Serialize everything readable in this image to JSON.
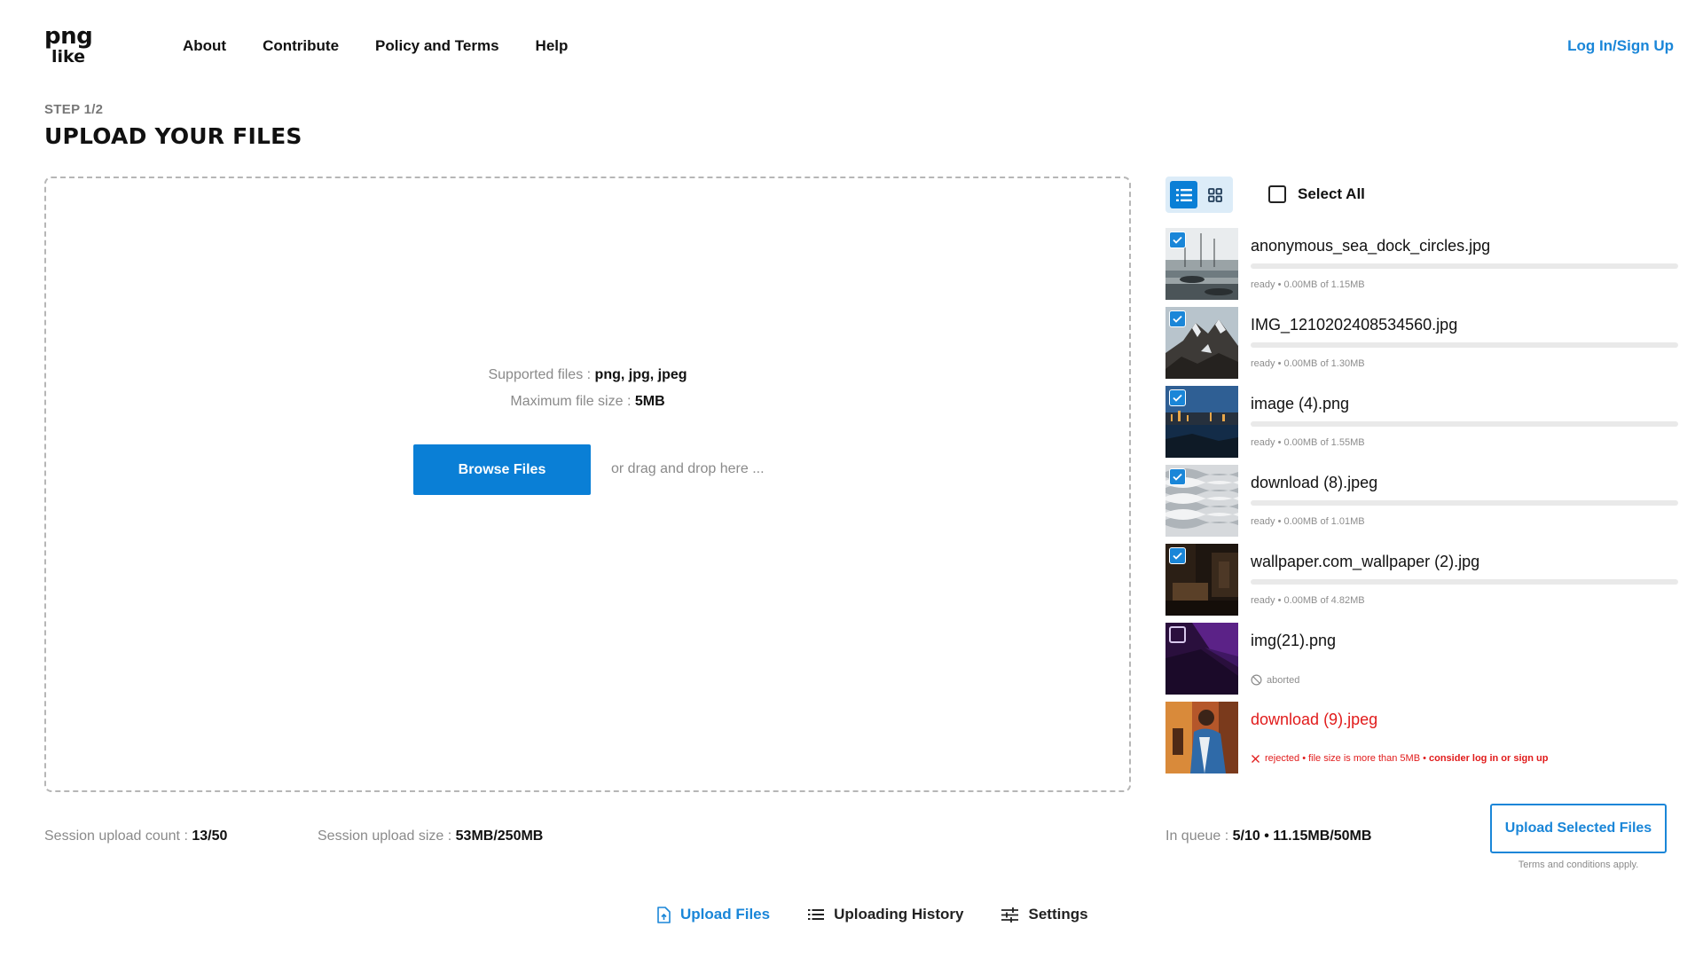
{
  "header": {
    "logo_line1": "png",
    "logo_line2": "like",
    "nav": [
      "About",
      "Contribute",
      "Policy and Terms",
      "Help"
    ],
    "login": "Log In/Sign Up"
  },
  "step": {
    "label": "STEP 1/2",
    "title": "UPLOAD YOUR FILES"
  },
  "dropzone": {
    "supported_label": "Supported files : ",
    "supported_value": "png, jpg, jpeg",
    "maxsize_label": "Maximum file size : ",
    "maxsize_value": "5MB",
    "browse_label": "Browse Files",
    "drag_hint": "or drag and drop here ..."
  },
  "panel": {
    "view_modes": [
      "list-icon",
      "grid-icon"
    ],
    "active_view": "list",
    "select_all": "Select All"
  },
  "files": [
    {
      "name": "anonymous_sea_dock_circles.jpg",
      "checked": true,
      "status": "ready • 0.00MB of 1.15MB",
      "state": "ready",
      "progress": 0
    },
    {
      "name": "IMG_1210202408534560.jpg",
      "checked": true,
      "status": "ready • 0.00MB of 1.30MB",
      "state": "ready",
      "progress": 0
    },
    {
      "name": "image (4).png",
      "checked": true,
      "status": "ready • 0.00MB of 1.55MB",
      "state": "ready",
      "progress": 0
    },
    {
      "name": "download (8).jpeg",
      "checked": true,
      "status": "ready • 0.00MB of 1.01MB",
      "state": "ready",
      "progress": 0
    },
    {
      "name": "wallpaper.com_wallpaper (2).jpg",
      "checked": true,
      "status": "ready • 0.00MB of 4.82MB",
      "state": "ready",
      "progress": 0
    },
    {
      "name": "img(21).png",
      "checked": false,
      "status": "aborted",
      "state": "aborted"
    },
    {
      "name": "download (9).jpeg",
      "checked": false,
      "status": "rejected • file size is more than 5MB • ",
      "status_emph": "consider log in or sign up",
      "state": "rejected"
    }
  ],
  "footer": {
    "session_count_label": "Session upload count : ",
    "session_count_value": "13/50",
    "session_size_label": "Session upload size : ",
    "session_size_value": "53MB/250MB",
    "queue_label": "In queue : ",
    "queue_value": "5/10 • 11.15MB/50MB",
    "upload_button": "Upload Selected Files",
    "terms": "Terms and conditions apply."
  },
  "tabs": [
    {
      "label": "Upload Files",
      "icon": "upload-file-icon",
      "active": true
    },
    {
      "label": "Uploading History",
      "icon": "list-icon",
      "active": false
    },
    {
      "label": "Settings",
      "icon": "sliders-icon",
      "active": false
    }
  ],
  "colors": {
    "accent": "#0a7fd6",
    "link": "#1a86d8",
    "error": "#e11b1b",
    "muted": "#8a8a8a"
  }
}
